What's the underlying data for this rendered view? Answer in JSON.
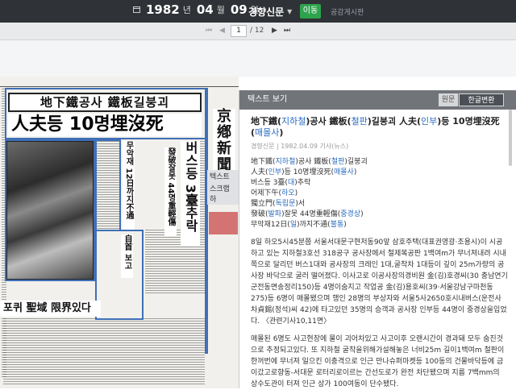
{
  "topbar": {
    "year": "1982",
    "year_unit": "년",
    "month": "04",
    "month_unit": "월",
    "day": "09",
    "day_unit": "일",
    "newspaper": "경향신문",
    "go_button": "이동",
    "board_link": "공감게시판"
  },
  "pager": {
    "current_page": "1",
    "total": "/ 12"
  },
  "newspaper_image": {
    "banner_headline": "地下鐵공사 鐵板길붕괴",
    "main_headline": "人夫등 10명埋沒死",
    "vertical_heads": [
      "버스등 3臺추락",
      "무악재 12日까지不通",
      "發破잘못 44명重輕傷",
      "自首 보고"
    ],
    "box_headline": "포퀴 聖域 限界있다",
    "masthead_side": "京鄕新聞",
    "overlay_labels": [
      "텍스트 보",
      "스크랩 하"
    ]
  },
  "panel": {
    "header": "텍스트 보기",
    "toggle_original": "원문",
    "toggle_converted": "한글변환",
    "title_parts": [
      "地下鐵(",
      "지하철",
      ")공사 鐵板(",
      "철판",
      ")길붕괴 人夫(",
      "인부",
      ")등 10명埋沒死(",
      "매몰사",
      ")"
    ],
    "meta": "경향신문 | 1982.04.09 기사(뉴스)",
    "lines": [
      [
        "地下鐵(",
        "지하철",
        ")공사 鐵板(",
        "철판",
        ")길붕괴"
      ],
      [
        "人夫(",
        "인부",
        ")등 10명埋沒死(",
        "매몰사",
        ")"
      ],
      [
        "버스등 3臺(",
        "대",
        ")추락"
      ],
      [
        "어제下午(",
        "하오",
        ")"
      ],
      [
        "獨立門(",
        "독립문",
        ")서"
      ],
      [
        "發破(",
        "발파",
        ")잘못 44명重輕傷(",
        "중경상",
        ")"
      ],
      [
        "무악재12日(",
        "일",
        ")까지不通(",
        "불통",
        ")"
      ]
    ],
    "paragraph1": "8일 하오5시45분쯤 서울서대문구현저동90앞 삼호주택(대표권영광·조용시)이 시공하고 있는 지하철3호선 318공구 공사장에서 철제복공판 1백여m가 무너져내려 시내쪽으로 달리던 버스1대와 공사장의 크레인 1대,굴착차 1대등이 깊이 25m가량의 공사장 바닥으로 굴러 떨어졌다. 이사고로 이공사장의경비원 金(김)호경씨(30 충남연기군전동면송정리150)등 4명이숨지고 작업공 金(김)용호씨(39·서울강남구마천동275)등 6명이 매몰됐으며 행인 28명의 부상자와 서울5사2650호시내버스(운전사 차貞錫(정석)씨 42)에 타고있던 35명의 승객과 공사장 인부등 44명이 중경상을입었다. 〈관련기사10,11면〉",
    "paragraph2": "매몰된 6명도 사고현장에 물이 괴어차있고 사고이후 오랜시간이 경과돼 모두 숨진것으로 추정되고있다. 또 지하철 굴착을위해가설해놓은 너비25m 길이1백여m 철판이 한꺼번에 무너져 일으킨 이충격으로 인근 만나슈퍼마켓등 100동의 건물바닥등에 금이갔고로향동-서대문 로터리로이르는 간선도로가 완전 차단됐으며 지름 7백mm의 상수도관이 터져 인근 상가 100여동이 단수됐다."
  }
}
